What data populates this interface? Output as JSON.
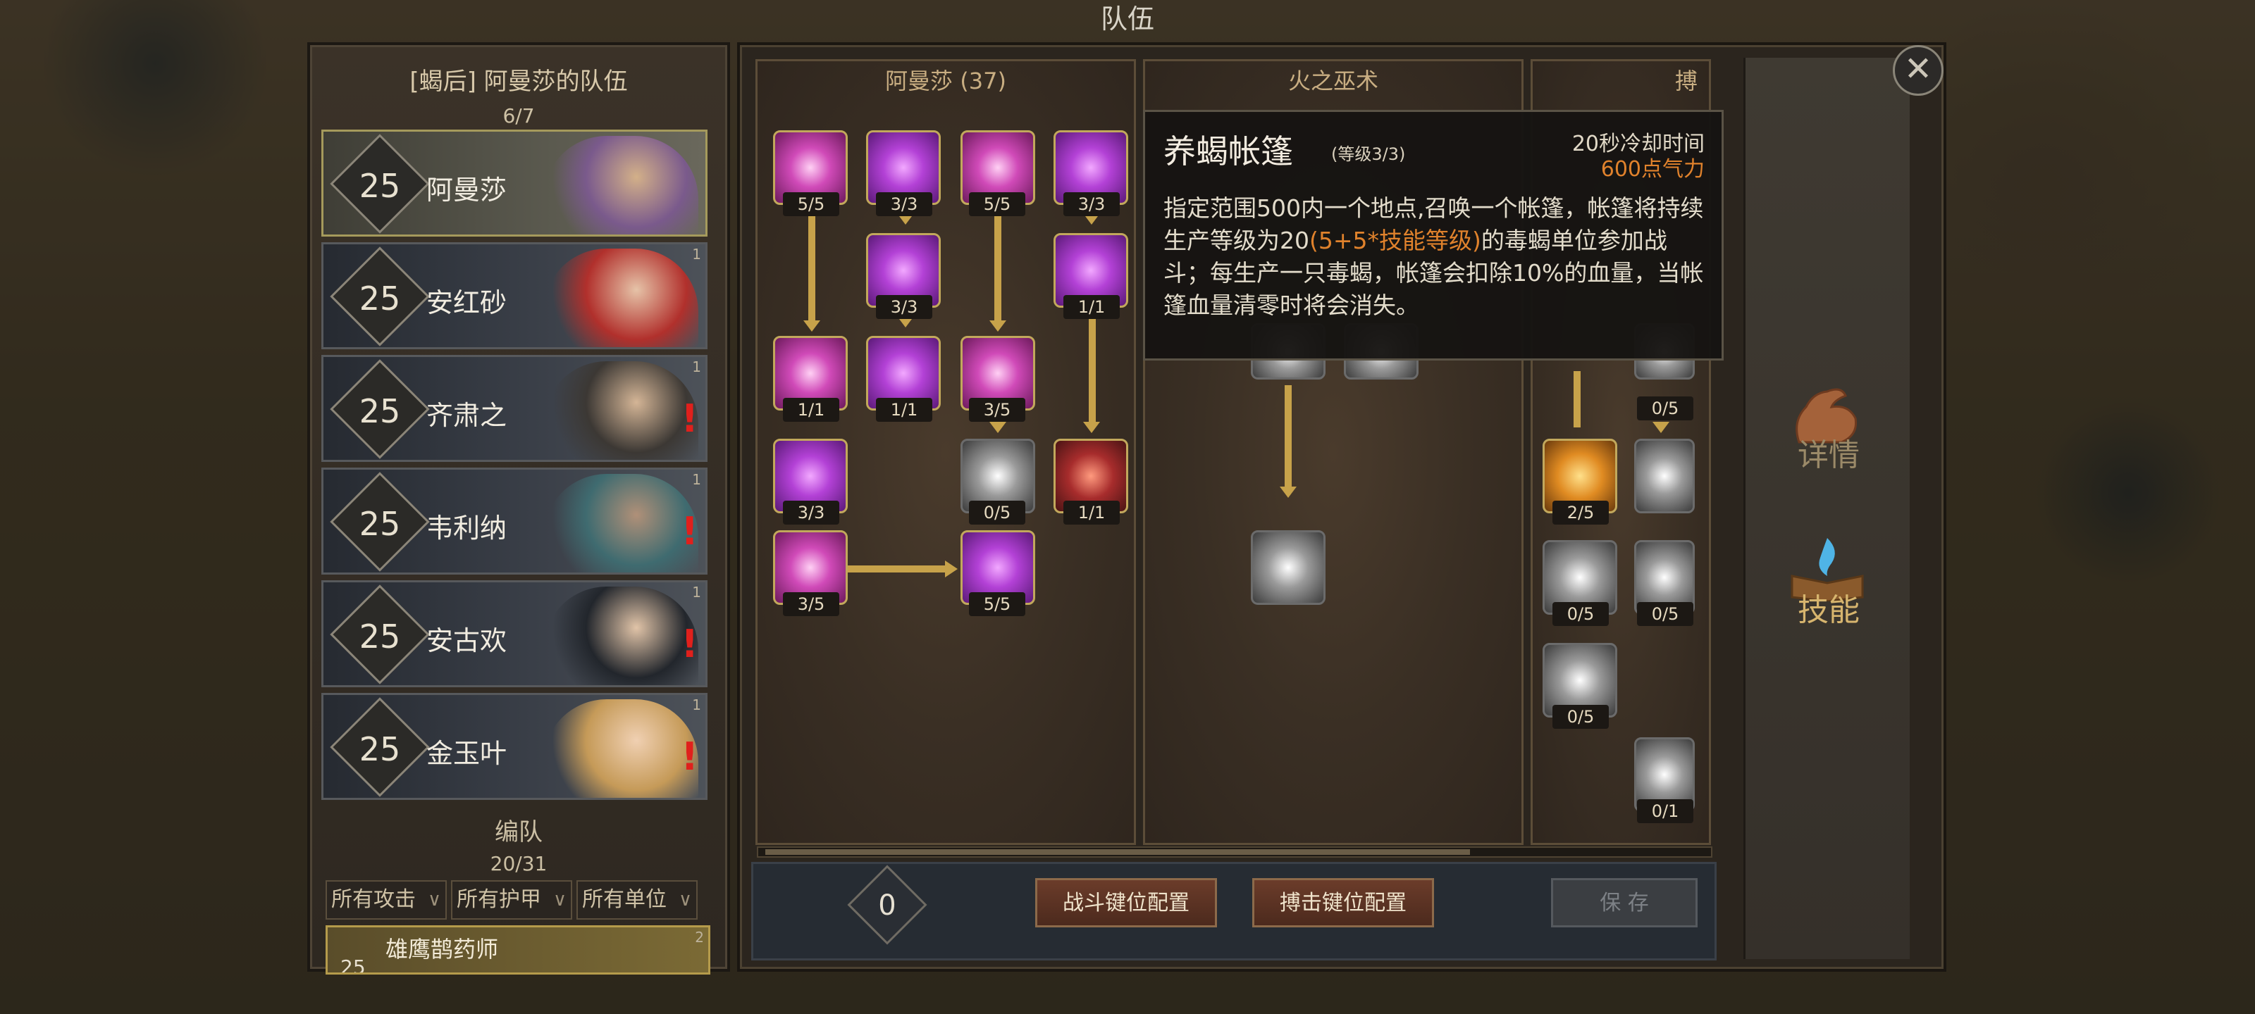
{
  "window": {
    "title": "队伍"
  },
  "team": {
    "title": "[蝎后] 阿曼莎的队伍",
    "count": "6/7",
    "heroes": [
      {
        "level": "25",
        "name": "阿曼莎",
        "selected": true,
        "alert": "",
        "rank": ""
      },
      {
        "level": "25",
        "name": "安红砂",
        "selected": false,
        "alert": "",
        "rank": "1"
      },
      {
        "level": "25",
        "name": "齐肃之",
        "selected": false,
        "alert": "!",
        "rank": "1"
      },
      {
        "level": "25",
        "name": "韦利纳",
        "selected": false,
        "alert": "!",
        "rank": "1"
      },
      {
        "level": "25",
        "name": "安古欢",
        "selected": false,
        "alert": "!",
        "rank": "1"
      },
      {
        "level": "25",
        "name": "金玉叶",
        "selected": false,
        "alert": "!",
        "rank": "1"
      }
    ]
  },
  "formation": {
    "title": "编队",
    "count": "20/31",
    "filters": [
      "所有攻击",
      "所有护甲",
      "所有单位"
    ],
    "unit": {
      "name": "雄鹰鹊药师",
      "level": "25",
      "rank": "2"
    }
  },
  "skill_trees": {
    "tree1": {
      "header": "阿曼莎 (37)",
      "skills": [
        "5/5",
        "3/3",
        "5/5",
        "3/3",
        "3/3",
        "1/1",
        "1/1",
        "1/1",
        "3/5",
        "3/3",
        "0/5",
        "1/1",
        "3/5",
        "5/5"
      ]
    },
    "tree2": {
      "header": "火之巫术",
      "skills": []
    },
    "tree3": {
      "header": "搏",
      "skills": [
        "0/5",
        "2/5",
        "0/5",
        "0/5",
        "0/5",
        "0/1"
      ]
    }
  },
  "bottom": {
    "points": "0",
    "battle_keys": "战斗键位配置",
    "grapple_keys": "搏击键位配置",
    "save": "保 存"
  },
  "side_tabs": {
    "details": "详情",
    "skills": "技能"
  },
  "tooltip": {
    "title": "养蝎帐篷",
    "level": "(等级3/3)",
    "cooldown": "20秒冷却时间",
    "cost": "600点气力",
    "desc_part1": "指定范围500内一个地点,召唤一个帐篷，帐篷将持续生产等级为20",
    "desc_highlight": "(5+5*技能等级)",
    "desc_part2": "的毒蝎单位参加战斗；每生产一只毒蝎，帐篷会扣除10%的血量，当帐篷血量清零时将会消失。"
  },
  "colors": {
    "accent_gold": "#c7a24a",
    "highlight_orange": "#e0822c",
    "alert_red": "#e0201c"
  },
  "icons": {
    "close": "close-icon",
    "details": "flexed-arm-icon",
    "skills": "spellbook-flame-icon"
  }
}
